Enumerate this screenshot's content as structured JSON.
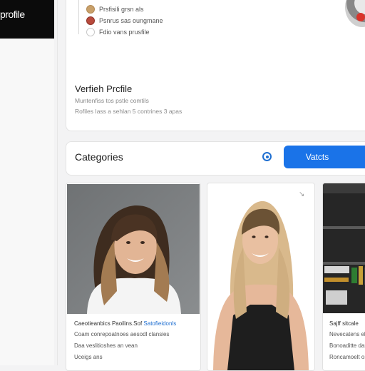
{
  "sidebar": {
    "logo_text": "profile"
  },
  "activity": {
    "items": [
      {
        "text": "Prsfisili grsn als",
        "icon": "avatar-icon",
        "color": "#c8a06a"
      },
      {
        "text": "Psnrus sas oungmane",
        "icon": "avatar-icon",
        "color": "#b84a3c"
      },
      {
        "text": "Fdio vans prusfile",
        "icon": "circle-icon",
        "color": "#ffffff"
      }
    ]
  },
  "verify": {
    "title": "Verfieh Prcfile",
    "sub1": "Muntenfiss tos pstle comtils",
    "sub2": "Rofiles Iass a sehlan 5 contrines 3 apas"
  },
  "categories": {
    "label": "Categories",
    "button_label": "Vatcts",
    "icon": "target-icon"
  },
  "profiles": [
    {
      "cap1a": "Caeotieanbics",
      "cap1b": "Paoilins.Sof",
      "cap1c": "Satofieidonls",
      "cap2": "Coam conrepoatnoes aesodl clansies",
      "cap3": "Daa veslitioshes an vean",
      "cap4": "Uceigs ans"
    },
    {
      "cap1a": "",
      "cap1b": "",
      "cap1c": "",
      "cap2": "",
      "cap3": "",
      "cap4": "",
      "corner_icon": "expand-icon"
    },
    {
      "cap1a": "Sajff sitcale",
      "cap2": "Nevecatens elocsa",
      "cap3": "Bonoaditte das",
      "cap4": "Roncamoelt ons"
    }
  ],
  "colors": {
    "accent": "#1a73e8",
    "icon_blue": "#1f6fd1"
  }
}
